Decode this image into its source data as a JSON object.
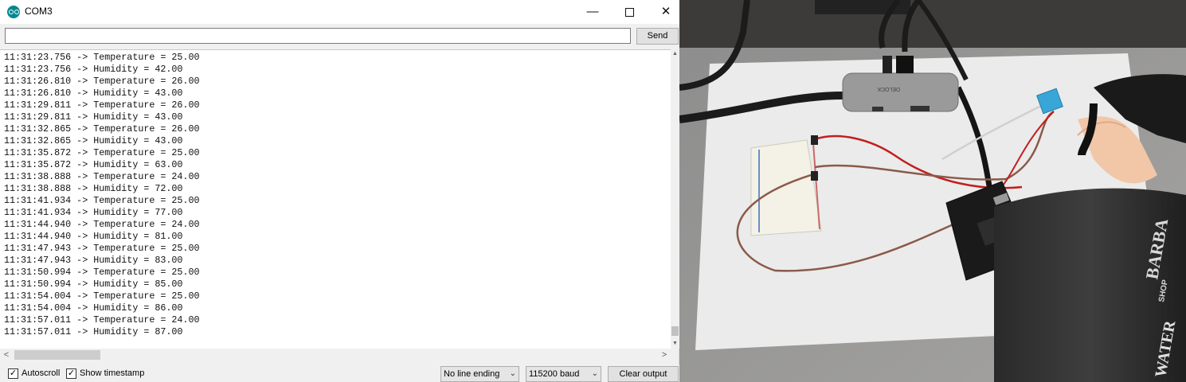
{
  "window": {
    "title": "COM3",
    "controls": {
      "minimize": "—",
      "maximize": "",
      "close": "✕"
    }
  },
  "send_bar": {
    "input_value": "",
    "send_label": "Send"
  },
  "output_lines": [
    "11:31:23.756 -> Temperature = 25.00",
    "11:31:23.756 -> Humidity = 42.00",
    "11:31:26.810 -> Temperature = 26.00",
    "11:31:26.810 -> Humidity = 43.00",
    "11:31:29.811 -> Temperature = 26.00",
    "11:31:29.811 -> Humidity = 43.00",
    "11:31:32.865 -> Temperature = 26.00",
    "11:31:32.865 -> Humidity = 43.00",
    "11:31:35.872 -> Temperature = 25.00",
    "11:31:35.872 -> Humidity = 63.00",
    "11:31:38.888 -> Temperature = 24.00",
    "11:31:38.888 -> Humidity = 72.00",
    "11:31:41.934 -> Temperature = 25.00",
    "11:31:41.934 -> Humidity = 77.00",
    "11:31:44.940 -> Temperature = 24.00",
    "11:31:44.940 -> Humidity = 81.00",
    "11:31:47.943 -> Temperature = 25.00",
    "11:31:47.943 -> Humidity = 83.00",
    "11:31:50.994 -> Temperature = 25.00",
    "11:31:50.994 -> Humidity = 85.00",
    "11:31:54.004 -> Temperature = 25.00",
    "11:31:54.004 -> Humidity = 86.00",
    "11:31:57.011 -> Temperature = 24.00",
    "11:31:57.011 -> Humidity = 87.00"
  ],
  "footer": {
    "autoscroll_label": "Autoscroll",
    "autoscroll_checked": true,
    "timestamp_label": "Show timestamp",
    "timestamp_checked": true,
    "line_ending": "No line ending",
    "baud": "115200 baud",
    "clear_label": "Clear output"
  },
  "icons": {
    "app": "arduino-icon",
    "check": "✓",
    "caret": "⌄",
    "scroll_up": "▲",
    "scroll_down": "▼",
    "scroll_left": "<",
    "scroll_right": ">"
  },
  "colors": {
    "accent": "#00878f",
    "window_bg": "#f0f0f0",
    "output_bg": "#ffffff"
  },
  "photo": {
    "hub_brand": "DELOCK",
    "bottle_text": [
      "BARBA",
      "SHOP",
      "WATER"
    ]
  }
}
